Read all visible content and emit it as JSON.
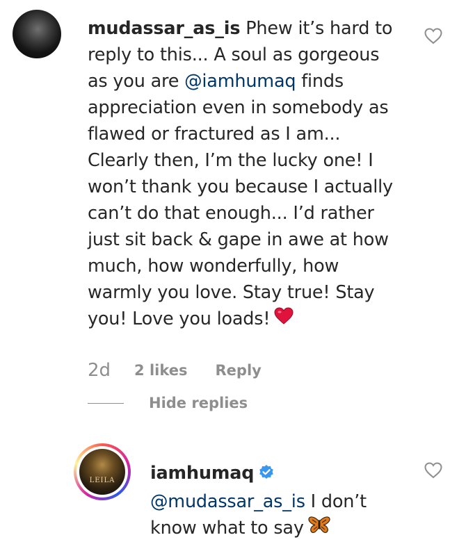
{
  "comment": {
    "username": "mudassar_as_is",
    "text_before_mention": "Phew it’s hard to reply to this... A soul as gorgeous as you are ",
    "mention": "@iamhumaq",
    "text_after_mention": " finds appreciation even in somebody as flawed or fractured as I am... Clearly then, I’m the lucky one! I won’t thank you because I actually can’t do that enough... I’d rather just sit back & gape in awe at how much, how wonderfully, how warmly you love. Stay true! Stay you! Love you loads!",
    "emoji": "red-heart",
    "timestamp": "2d",
    "likes": "2 likes",
    "reply_label": "Reply",
    "hide_replies_label": "Hide replies"
  },
  "reply": {
    "username": "iamhumaq",
    "verified": true,
    "mention": "@mudassar_as_is",
    "text": " I don’t know what to say",
    "emoji": "butterfly",
    "avatar_logo_text": "LEILA"
  },
  "colors": {
    "text": "#262626",
    "secondary": "#8e8e8e",
    "mention": "#00376b",
    "verified": "#3897f0",
    "heart": "#e0133c"
  }
}
